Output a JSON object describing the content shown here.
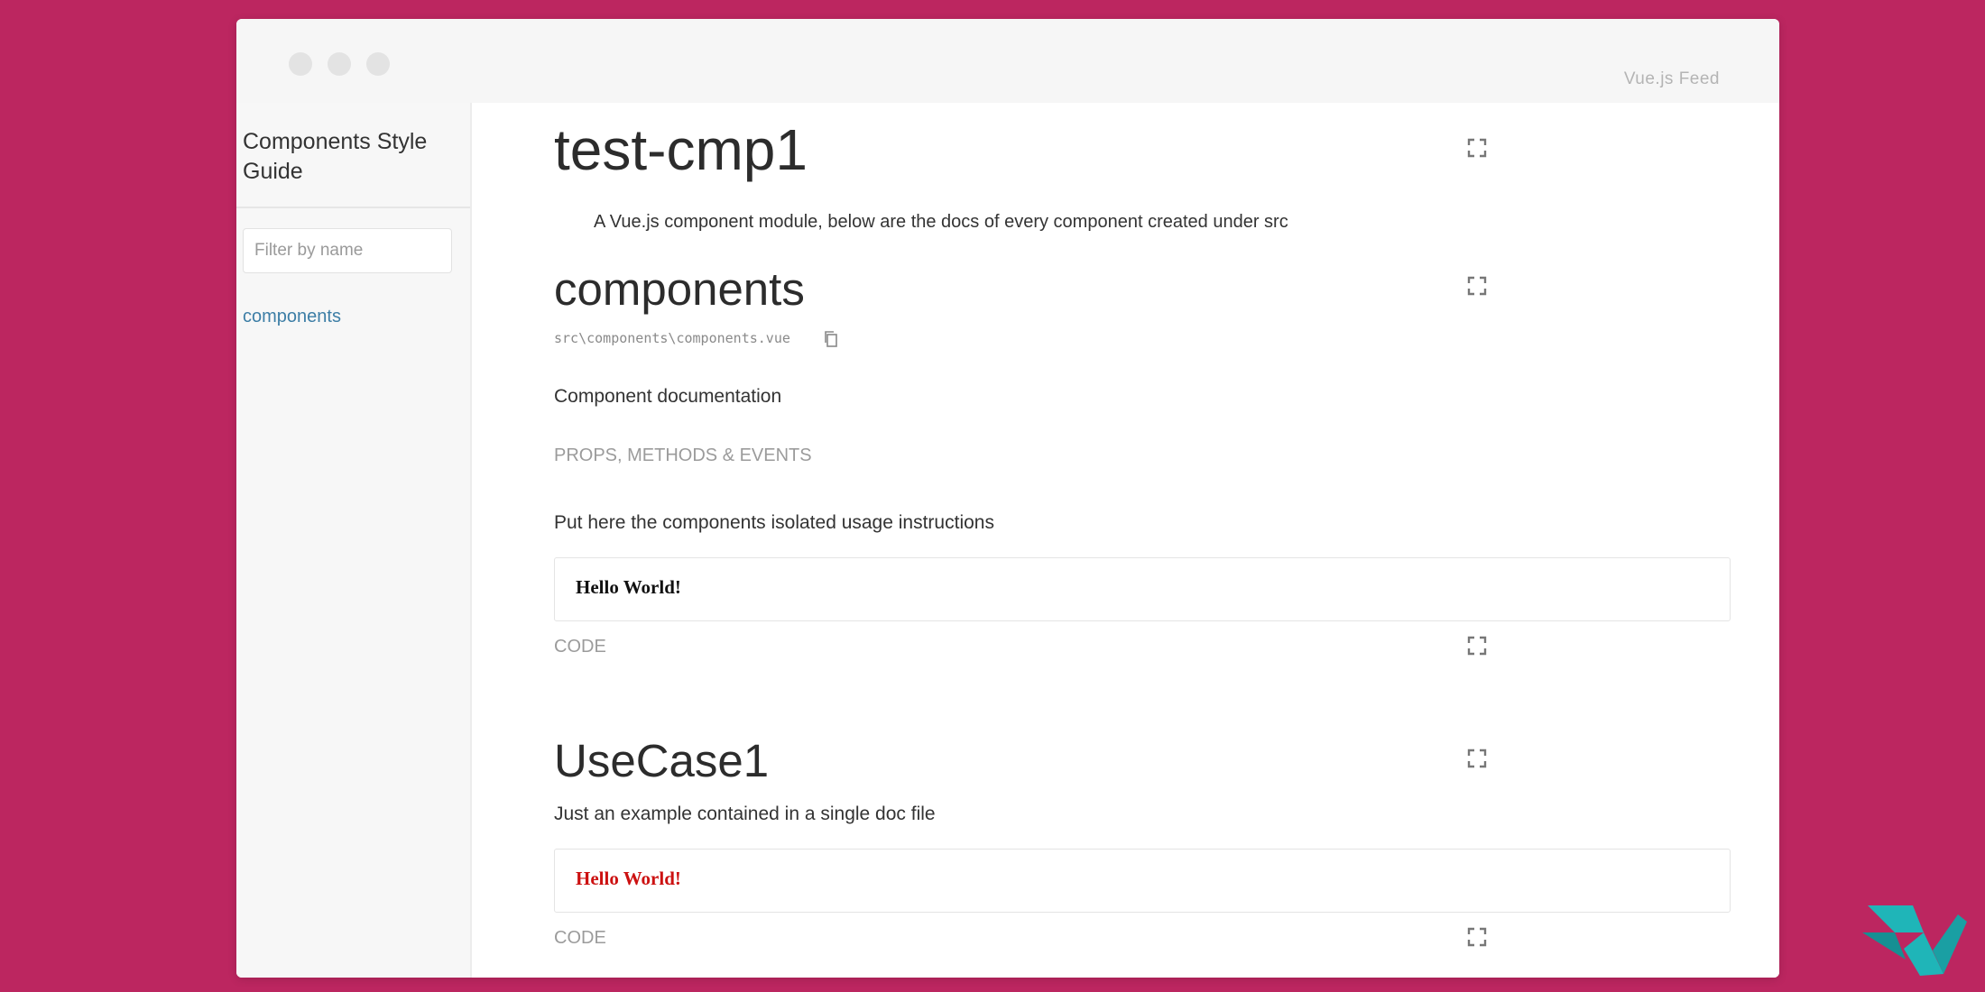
{
  "header": {
    "brand": "Vue.js Feed"
  },
  "sidebar": {
    "title": "Components Style Guide",
    "filter_placeholder": "Filter by name",
    "items": [
      {
        "label": "components"
      }
    ]
  },
  "main": {
    "module_title": "test-cmp1",
    "module_description": "A Vue.js component module, below are the docs of every component created under src",
    "component": {
      "title": "components",
      "path": "src\\components\\components.vue",
      "description": "Component documentation",
      "props_label": "PROPS, METHODS & EVENTS",
      "usage": "Put here the components isolated usage instructions",
      "demo_text": "Hello World!",
      "code_label": "CODE"
    },
    "usecase": {
      "title": "UseCase1",
      "description": "Just an example contained in a single doc file",
      "demo_text": "Hello World!",
      "code_label": "CODE"
    }
  },
  "colors": {
    "background": "#bc2660",
    "link": "#3d7ea6",
    "demo_black": "#111111",
    "demo_red": "#cc1111",
    "logo_teal": "#1fb5b8"
  },
  "icons": [
    "expand-icon",
    "copy-icon",
    "vue-feed-logo"
  ]
}
